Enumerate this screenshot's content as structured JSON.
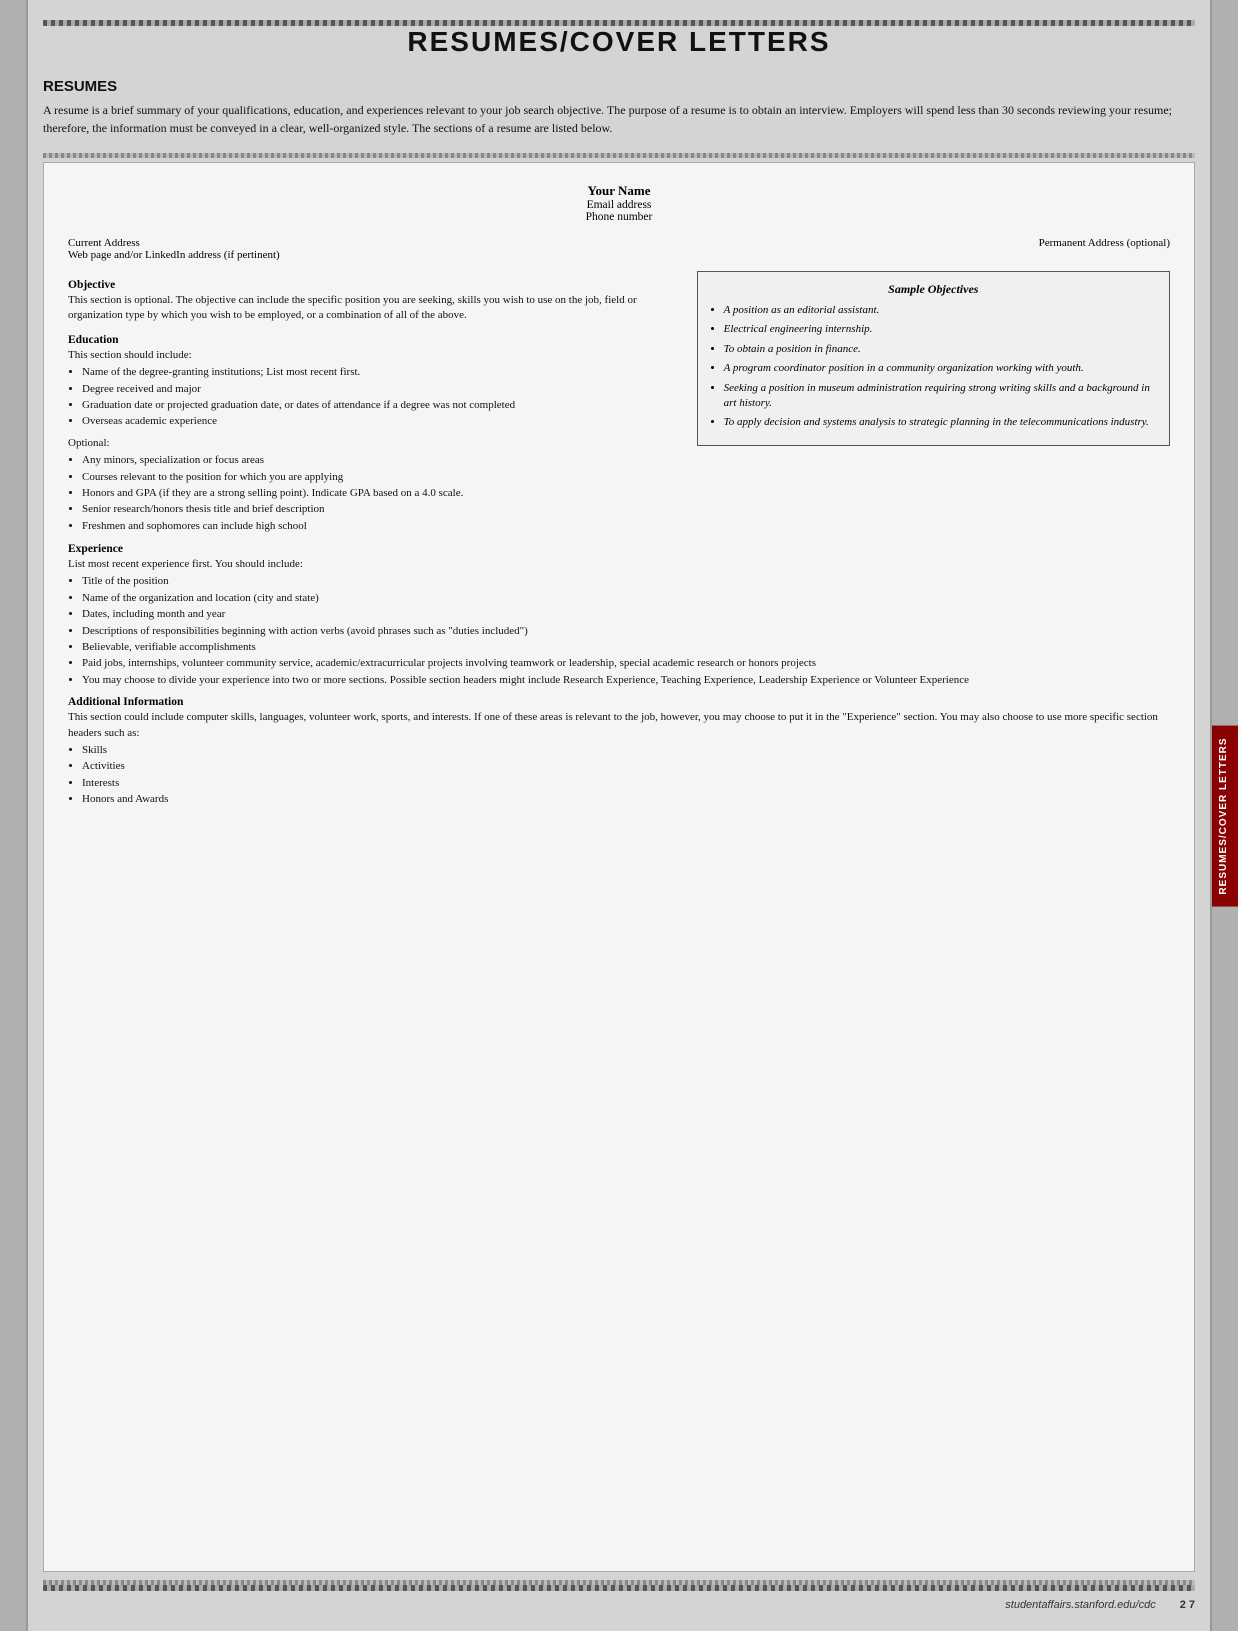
{
  "page": {
    "title": "RESUMES/COVER LETTERS",
    "section_heading": "RESUMES",
    "intro": "A resume is a brief summary of your qualifications, education, and experiences relevant to your job search objective. The purpose of a resume is to obtain an interview. Employers will spend less than 30 seconds reviewing your resume; therefore, the information must be conveyed in a clear, well-organized style. The sections of a resume are listed below."
  },
  "resume_template": {
    "your_name": "Your Name",
    "email": "Email address",
    "phone": "Phone number",
    "current_address": "Current Address",
    "web_address": "Web page and/or LinkedIn address (if pertinent)",
    "permanent_address": "Permanent Address (optional)",
    "objective_title": "Objective",
    "objective_text": "This section is optional. The objective can include the specific position you are seeking, skills you wish to use on the job, field or organization type by which you wish to be employed, or a combination of all of the above.",
    "education_title": "Education",
    "education_intro": "This section should include:",
    "education_items": [
      "Name of the degree-granting institutions; List most recent first.",
      "Degree received and major",
      "Graduation date or projected graduation date, or dates of attendance if a degree was not completed",
      "Overseas academic experience"
    ],
    "optional_label": "Optional:",
    "optional_items": [
      "Any minors, specialization or focus areas",
      "Courses relevant to the position for which you are applying",
      "Honors and GPA (if they are a strong selling point). Indicate GPA based on a 4.0 scale.",
      "Senior research/honors thesis title and brief description",
      "Freshmen and sophomores can include high school"
    ],
    "experience_title": "Experience",
    "experience_intro": "List most recent experience first. You should include:",
    "experience_items": [
      "Title of the position",
      "Name of the organization and location (city and state)",
      "Dates, including month and year",
      "Descriptions of responsibilities beginning with action verbs (avoid phrases such as \"duties included\")",
      "Believable, verifiable accomplishments",
      "Paid jobs, internships, volunteer community service, academic/extracurricular projects involving teamwork or leadership, special academic research or honors projects",
      "You may choose to divide your experience into two or more sections. Possible section headers might include Research Experience, Teaching Experience, Leadership Experience or Volunteer Experience"
    ],
    "additional_title": "Additional Information",
    "additional_text": "This section could include computer skills, languages, volunteer work, sports, and interests. If one of these areas is relevant to the job, however, you may choose to put it in the \"Experience\" section. You may also choose to use more specific section headers such as:",
    "additional_items": [
      "Skills",
      "Activities",
      "Interests",
      "Honors and Awards"
    ]
  },
  "sample_objectives": {
    "title": "Sample Objectives",
    "items": [
      "A position as an editorial assistant.",
      "Electrical engineering internship.",
      "To obtain a position in finance.",
      "A program coordinator position in a community organization working with youth.",
      "Seeking a position in museum administration requiring strong writing skills and a background in art history.",
      "To apply decision and systems analysis to strategic planning in the telecommunications industry."
    ]
  },
  "right_tab_label": "RESUMES/COVER LETTERS",
  "footer": {
    "url": "studentaffairs.stanford.edu/cdc",
    "page": "2 7"
  }
}
